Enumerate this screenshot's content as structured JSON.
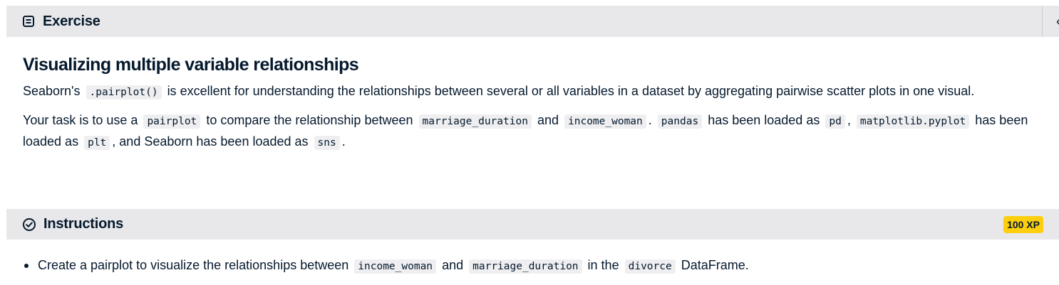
{
  "exercise_header": {
    "title": "Exercise",
    "icon": "document-icon",
    "collapse_icon": "chevron-left-icon",
    "collapse_glyph": "‹"
  },
  "exercise": {
    "title": "Visualizing multiple variable relationships",
    "para1": {
      "t1": "Seaborn's",
      "c1": ".pairplot()",
      "t2": "is excellent for understanding the relationships between several or all variables in a dataset by aggregating pairwise scatter plots in one visual."
    },
    "para2": {
      "t1": "Your task is to use a",
      "c1": "pairplot",
      "t2": "to compare the relationship between",
      "c2": "marriage_duration",
      "t3": "and",
      "c3": "income_woman",
      "t4": ".",
      "c4": "pandas",
      "t5": "has been loaded as",
      "c5": "pd",
      "t6": ",",
      "c6": "matplotlib.pyplot",
      "t7": "has been loaded as",
      "c7": "plt",
      "t8": ", and Seaborn has been loaded as",
      "c8": "sns",
      "t9": "."
    }
  },
  "instructions_header": {
    "title": "Instructions",
    "icon": "check-circle-icon",
    "xp_badge": "100 XP",
    "badge_color": "#fcce0d"
  },
  "instructions": {
    "items": [
      {
        "t1": "Create a pairplot to visualize the relationships between",
        "c1": "income_woman",
        "t2": "and",
        "c2": "marriage_duration",
        "t3": "in the",
        "c3": "divorce",
        "t4": "DataFrame."
      }
    ]
  }
}
